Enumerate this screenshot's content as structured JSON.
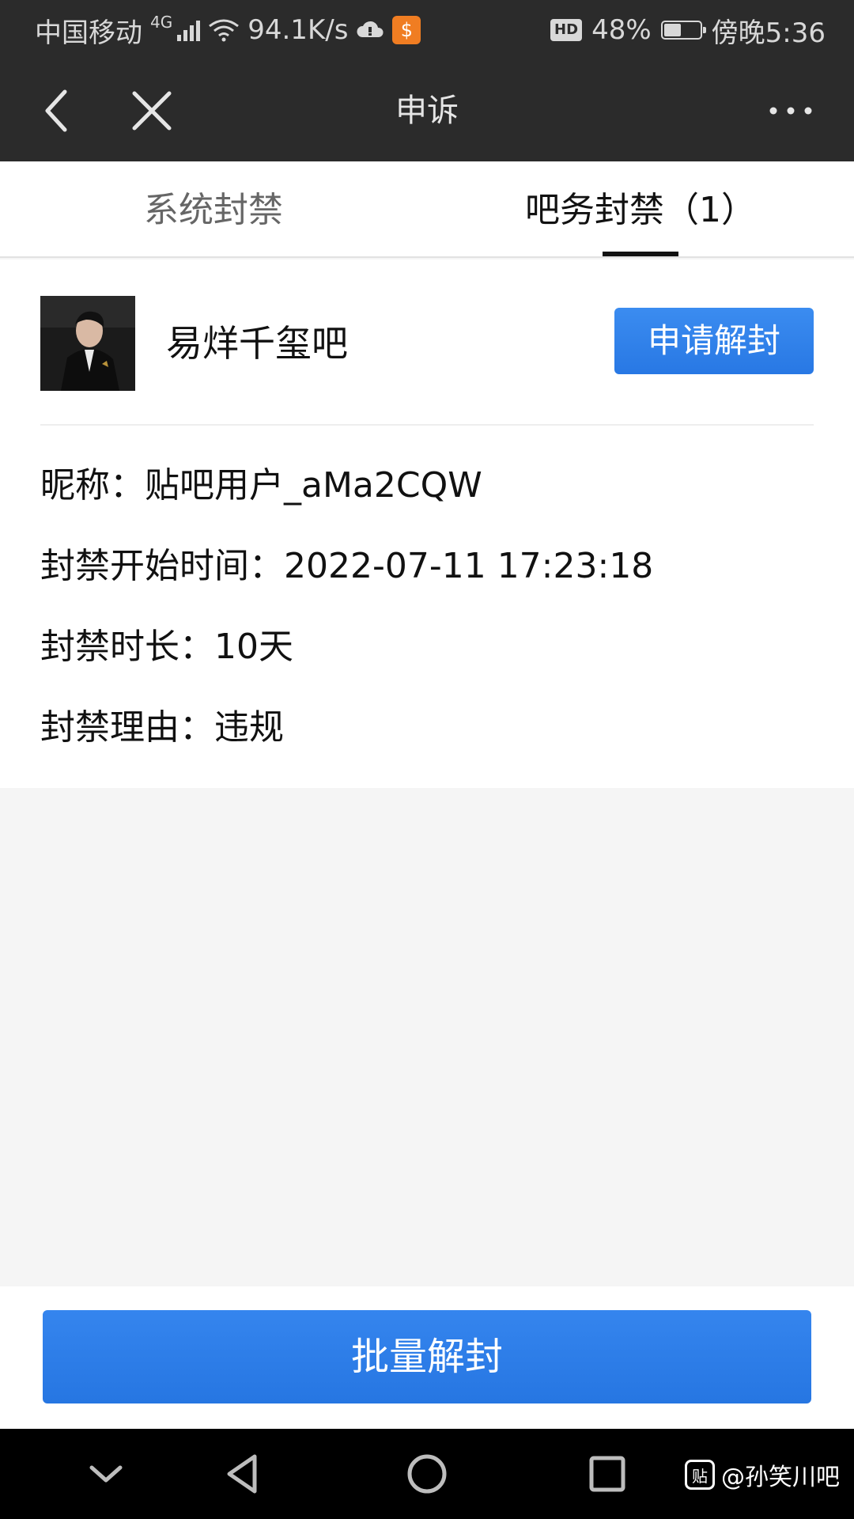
{
  "status_bar": {
    "carrier": "中国移动",
    "network_type": "4G",
    "speed": "94.1K/s",
    "hd_label": "HD",
    "battery_percent": "48%",
    "battery_level": 0.48,
    "time": "傍晚5:36"
  },
  "title_bar": {
    "title": "申诉",
    "back_icon": "back-arrow-icon",
    "close_icon": "close-icon",
    "more_icon": "more-dots-icon"
  },
  "tabs": [
    {
      "label": "系统封禁",
      "active": false
    },
    {
      "label": "吧务封禁（1）",
      "active": true
    }
  ],
  "ban_record": {
    "forum_name": "易烊千玺吧",
    "unban_button": "申请解封",
    "nickname_line": "昵称：贴吧用户_aMa2CQW",
    "start_time_line": "封禁开始时间：2022-07-11 17:23:18",
    "duration_line": "封禁时长：10天",
    "reason_line": "封禁理由：违规"
  },
  "footer": {
    "batch_button": "批量解封"
  },
  "nav_bar": {
    "icons": [
      "chevron-down-icon",
      "back-triangle-icon",
      "home-circle-icon",
      "recent-square-icon"
    ]
  },
  "watermark": {
    "icon_text": "贴",
    "text": "@孙笑川吧"
  },
  "colors": {
    "header_bg": "#2b2b2b",
    "accent_blue": "#2d7ee8",
    "page_bg": "#f5f5f5"
  }
}
